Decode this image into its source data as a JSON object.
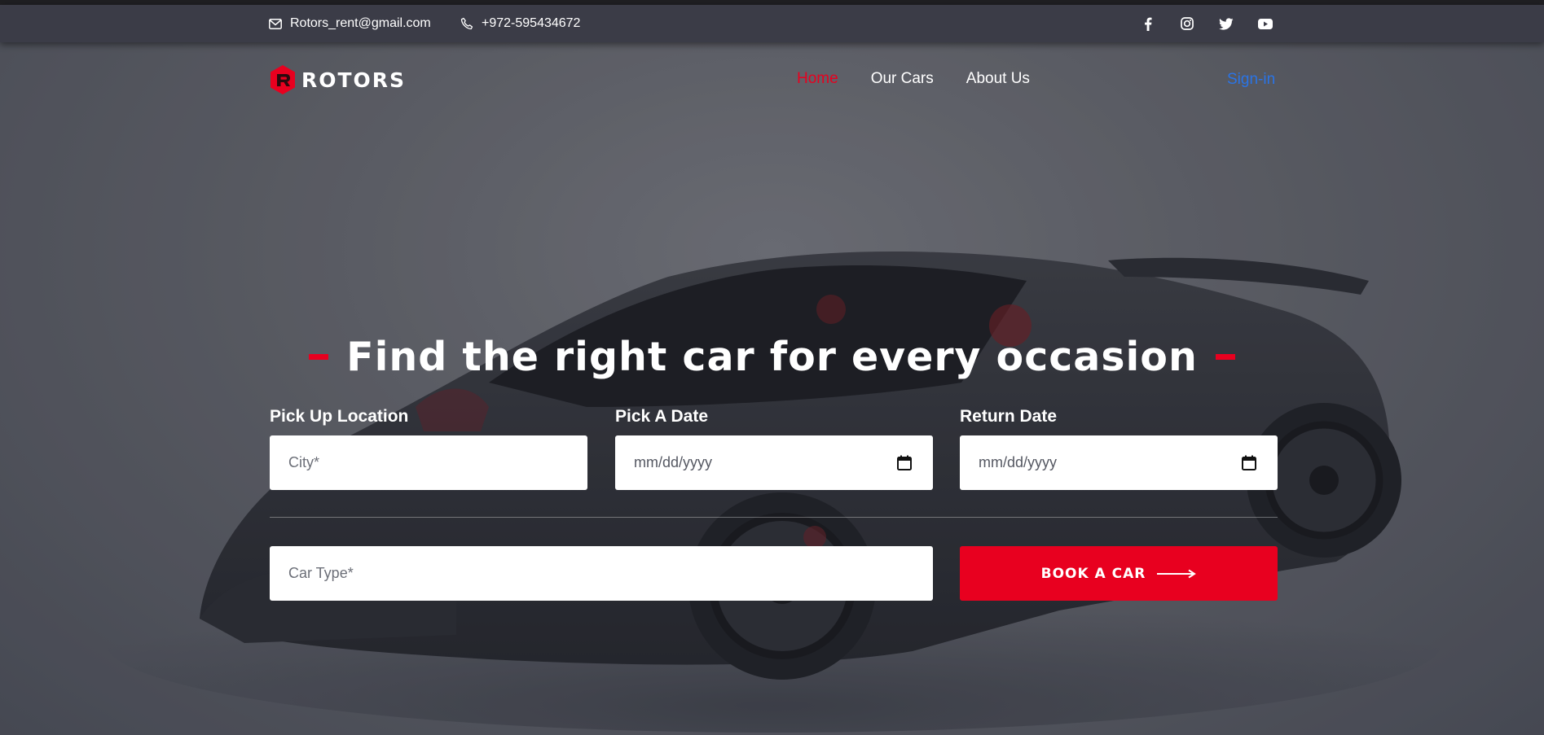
{
  "topbar": {
    "email": "Rotors_rent@gmail.com",
    "phone": "+972-595434672",
    "socials": [
      "facebook-icon",
      "instagram-icon",
      "twitter-icon",
      "youtube-icon"
    ]
  },
  "nav": {
    "logo_text": "ROTORS",
    "items": [
      {
        "label": "Home",
        "active": true
      },
      {
        "label": "Our Cars",
        "active": false
      },
      {
        "label": "About Us",
        "active": false
      }
    ],
    "signin": "Sign-in"
  },
  "hero": {
    "headline": "Find the right car for every occasion"
  },
  "form": {
    "pickup_label": "Pick Up Location",
    "pickup_placeholder": "City*",
    "pick_date_label": "Pick A Date",
    "pick_date_value": "mm/dd/yyyy",
    "return_label": "Return Date",
    "return_value": "mm/dd/yyyy",
    "car_type_placeholder": "Car Type*",
    "book_button": "BOOK A CAR"
  },
  "colors": {
    "accent": "#e8001f",
    "topbar": "#3b3c47",
    "signin": "#2a74e6"
  }
}
